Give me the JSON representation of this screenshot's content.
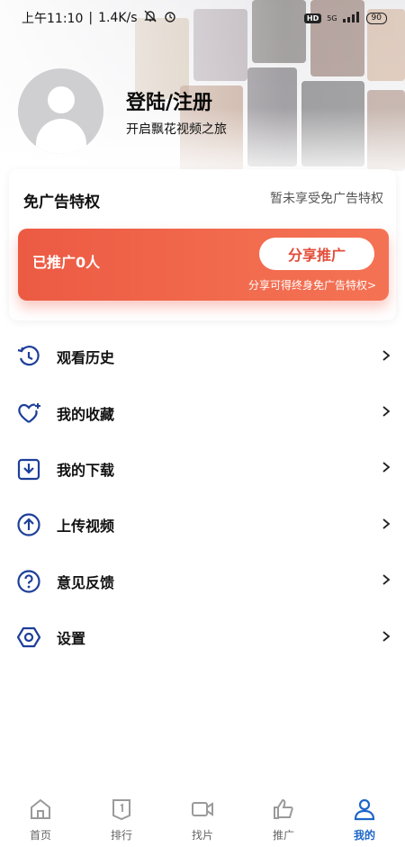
{
  "status_bar": {
    "time": "上午11:10",
    "speed": "1.4K/s",
    "network": "5G",
    "hd": "HD",
    "battery": "90"
  },
  "profile": {
    "title": "登陆/注册",
    "subtitle": "开启飘花视频之旅"
  },
  "ad_card": {
    "title": "免广告特权",
    "status": "暂未享受免广告特权",
    "promo_count": "已推广0人",
    "share_button": "分享推广",
    "hint": "分享可得终身免广告特权>"
  },
  "menu": {
    "items": [
      {
        "label": "观看历史",
        "icon": "history-icon"
      },
      {
        "label": "我的收藏",
        "icon": "favorite-icon"
      },
      {
        "label": "我的下载",
        "icon": "download-icon"
      },
      {
        "label": "上传视频",
        "icon": "upload-icon"
      },
      {
        "label": "意见反馈",
        "icon": "feedback-icon"
      },
      {
        "label": "设置",
        "icon": "settings-icon"
      }
    ]
  },
  "bottom_nav": {
    "items": [
      {
        "label": "首页",
        "icon": "home-icon",
        "active": false
      },
      {
        "label": "排行",
        "icon": "ranking-icon",
        "active": false
      },
      {
        "label": "找片",
        "icon": "video-icon",
        "active": false
      },
      {
        "label": "推广",
        "icon": "thumbs-up-icon",
        "active": false
      },
      {
        "label": "我的",
        "icon": "user-icon",
        "active": true
      }
    ]
  },
  "colors": {
    "accent_blue": "#1d66c8",
    "promo_red": "#ec5a43"
  }
}
